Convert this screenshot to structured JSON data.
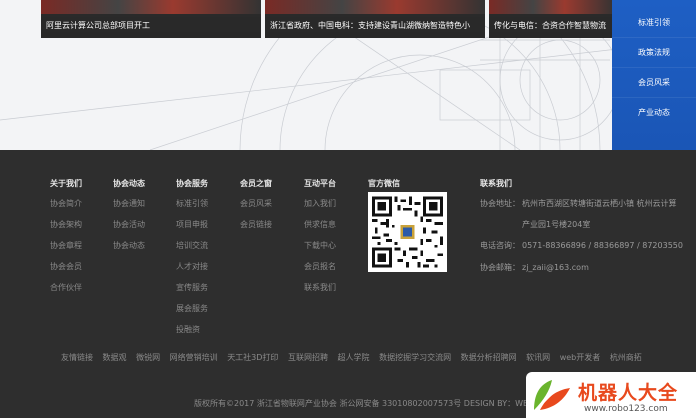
{
  "news": [
    {
      "caption": "阿里云计算公司总部项目开工"
    },
    {
      "caption": "浙江省政府、中国电科：支持建设青山湖微纳智造特色小"
    },
    {
      "caption": "传化与电信：合资合作智慧物流"
    }
  ],
  "side_menu": [
    "标准引领",
    "政策法规",
    "会员风采",
    "产业动态"
  ],
  "footer": {
    "columns": [
      {
        "title": "关于我们",
        "links": [
          "协会简介",
          "协会架构",
          "协会章程",
          "协会会员",
          "合作伙伴"
        ]
      },
      {
        "title": "协会动态",
        "links": [
          "协会通知",
          "协会活动",
          "协会动态"
        ]
      },
      {
        "title": "协会服务",
        "links": [
          "标准引领",
          "项目申报",
          "培训交流",
          "人才对接",
          "宣传服务",
          "展会服务",
          "投融资"
        ]
      },
      {
        "title": "会员之窗",
        "links": [
          "会员风采",
          "会员链接"
        ]
      },
      {
        "title": "互动平台",
        "links": [
          "加入我们",
          "供求信息",
          "下载中心",
          "会员报名",
          "联系我们"
        ]
      }
    ],
    "wechat_title": "官方微信",
    "contact": {
      "title": "联系我们",
      "address_label": "协会地址：",
      "address_line1": "杭州市西湖区转塘街道云栖小镇 杭州云计算",
      "address_line2": "产业园1号楼204室",
      "phone_label": "电话咨询：",
      "phone": "0571-88366896 / 88366897 / 87203550",
      "email_label": "协会邮箱：",
      "email": "zj_zaii@163.com"
    },
    "friend_links_label": "友情链接",
    "friend_links": [
      "数据观",
      "微锐网",
      "网络营销培训",
      "天工社3D打印",
      "互联网招聘",
      "超人学院",
      "数据挖掘学习交流网",
      "数据分析招聘网",
      "软讯网",
      "web开发者",
      "杭州商拓"
    ],
    "copyright": "版权所有©2017 浙江省物联网产业协会      浙公网安备 33010802007573号 DESIGN BY：WEETOP"
  },
  "watermark": {
    "title": "机器人大全",
    "url": "www.robo123.com"
  },
  "colors": {
    "side_menu": "#1e5fc4",
    "footer_bg": "#2e2e2e",
    "watermark_red": "#e8491d",
    "watermark_green": "#6ab42d"
  }
}
